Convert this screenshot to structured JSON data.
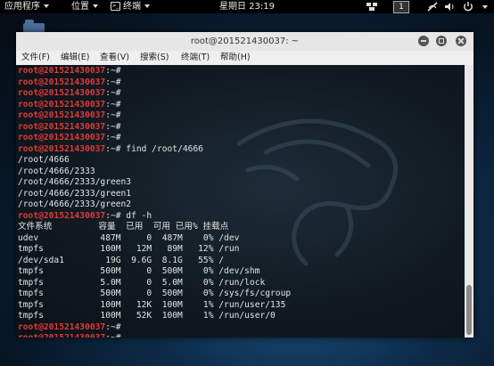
{
  "topbar": {
    "apps_menu": "应用程序",
    "places_menu": "位置",
    "terminal_menu": "终端",
    "clock": "星期日 23:19",
    "workspace": "1"
  },
  "window": {
    "title": "root@201521430037: ~",
    "menu": [
      "文件(F)",
      "编辑(E)",
      "查看(V)",
      "搜索(S)",
      "终端(T)",
      "帮助(H)"
    ]
  },
  "terminal": {
    "prompt_user": "root@201521430037",
    "prompt_path": ":~#",
    "lines": [
      {
        "type": "prompt",
        "cmd": ""
      },
      {
        "type": "prompt",
        "cmd": ""
      },
      {
        "type": "prompt",
        "cmd": ""
      },
      {
        "type": "prompt",
        "cmd": ""
      },
      {
        "type": "prompt",
        "cmd": ""
      },
      {
        "type": "prompt",
        "cmd": ""
      },
      {
        "type": "prompt",
        "cmd": ""
      },
      {
        "type": "prompt",
        "cmd": " find /root/4666"
      },
      {
        "type": "out",
        "text": "/root/4666"
      },
      {
        "type": "out",
        "text": "/root/4666/2333"
      },
      {
        "type": "out",
        "text": "/root/4666/2333/green3"
      },
      {
        "type": "out",
        "text": "/root/4666/2333/green1"
      },
      {
        "type": "out",
        "text": "/root/4666/2333/green2"
      },
      {
        "type": "prompt",
        "cmd": " df -h"
      },
      {
        "type": "out",
        "text": "文件系统         容量  已用  可用 已用% 挂载点"
      },
      {
        "type": "out",
        "text": "udev            487M     0  487M    0% /dev"
      },
      {
        "type": "out",
        "text": "tmpfs           100M   12M   89M   12% /run"
      },
      {
        "type": "out",
        "text": "/dev/sda1        19G  9.6G  8.1G   55% /"
      },
      {
        "type": "out",
        "text": "tmpfs           500M     0  500M    0% /dev/shm"
      },
      {
        "type": "out",
        "text": "tmpfs           5.0M     0  5.0M    0% /run/lock"
      },
      {
        "type": "out",
        "text": "tmpfs           500M     0  500M    0% /sys/fs/cgroup"
      },
      {
        "type": "out",
        "text": "tmpfs           100M   12K  100M    1% /run/user/135"
      },
      {
        "type": "out",
        "text": "tmpfs           100M   52K  100M    1% /run/user/0"
      },
      {
        "type": "prompt",
        "cmd": ""
      },
      {
        "type": "prompt",
        "cmd": ""
      }
    ]
  },
  "icons": {
    "apps": "caret-down-icon",
    "terminal": "terminal-icon",
    "network": "network-icon",
    "volume": "volume-icon",
    "power": "power-icon",
    "wifi_off": "no-network-icon",
    "folder": "folder-icon",
    "dragon": "kali-dragon-icon"
  },
  "colors": {
    "prompt_user": "#e03a3a",
    "terminal_bg": "#111a22",
    "panel": "#000000"
  }
}
